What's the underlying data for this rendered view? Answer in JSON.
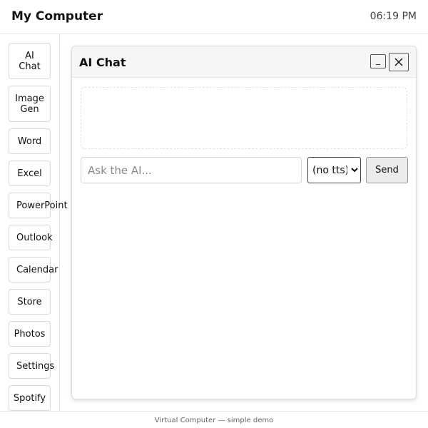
{
  "topbar": {
    "title": "My Computer",
    "clock": "06:19 PM"
  },
  "sidebar": {
    "items": [
      {
        "label": "AI\nChat"
      },
      {
        "label": "Image\nGen"
      },
      {
        "label": "Word"
      },
      {
        "label": "Excel"
      },
      {
        "label": "PowerPoint"
      },
      {
        "label": "Outlook"
      },
      {
        "label": "Calendar"
      },
      {
        "label": "Store"
      },
      {
        "label": "Photos"
      },
      {
        "label": "Settings"
      },
      {
        "label": "Spotify"
      }
    ]
  },
  "window": {
    "title": "AI Chat",
    "minimize_label": "_",
    "close_label": "✕",
    "input_placeholder": "Ask the AI...",
    "input_value": "",
    "tts_selected": "(no tts)",
    "send_label": "Send"
  },
  "footer": {
    "text": "Virtual Computer — simple demo"
  }
}
